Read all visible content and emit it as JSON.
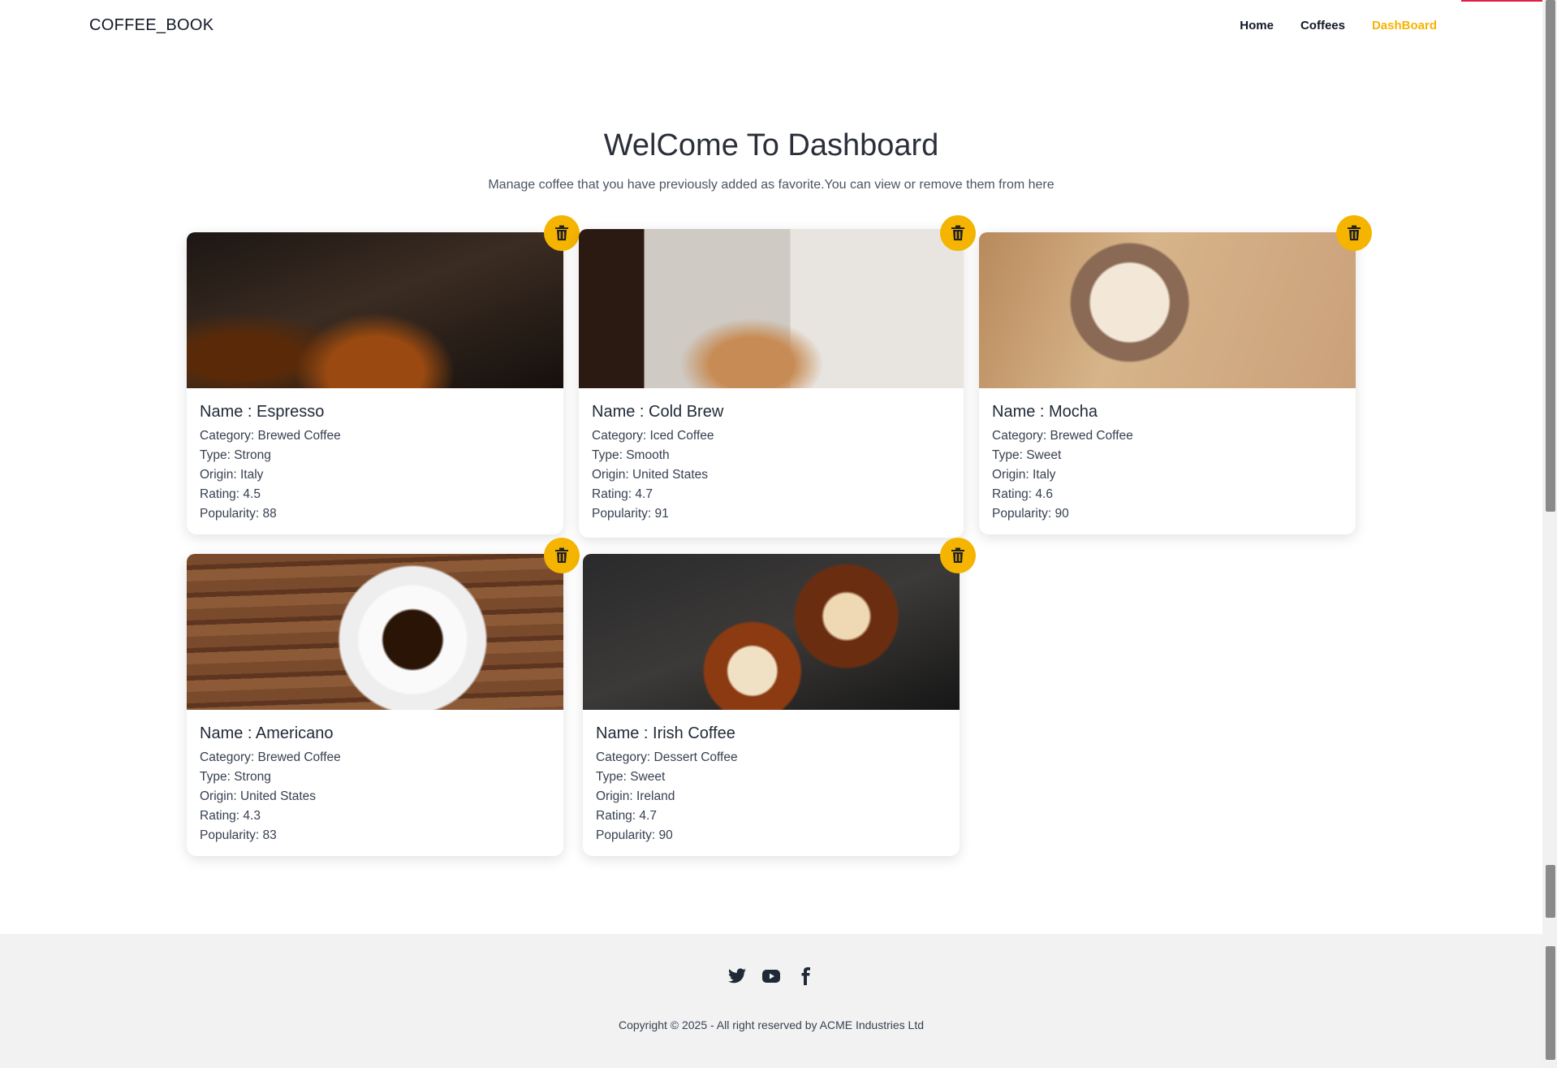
{
  "navbar": {
    "brand": "COFFEE_BOOK",
    "links": [
      {
        "label": "Home"
      },
      {
        "label": "Coffees"
      },
      {
        "label": "DashBoard"
      }
    ]
  },
  "hero": {
    "title": "WelCome To Dashboard",
    "subtitle": "Manage coffee that you have previously added as favorite.You can view or remove them from here"
  },
  "cards": [
    {
      "name": "Name : Espresso",
      "category": "Category: Brewed Coffee",
      "type": "Type: Strong",
      "origin": "Origin: Italy",
      "rating": "Rating: 4.5",
      "popularity": "Popularity: 88"
    },
    {
      "name": "Name : Cold Brew",
      "category": "Category: Iced Coffee",
      "type": "Type: Smooth",
      "origin": "Origin: United States",
      "rating": "Rating: 4.7",
      "popularity": "Popularity: 91"
    },
    {
      "name": "Name : Mocha",
      "category": "Category: Brewed Coffee",
      "type": "Type: Sweet",
      "origin": "Origin: Italy",
      "rating": "Rating: 4.6",
      "popularity": "Popularity: 90"
    },
    {
      "name": "Name : Americano",
      "category": "Category: Brewed Coffee",
      "type": "Type: Strong",
      "origin": "Origin: United States",
      "rating": "Rating: 4.3",
      "popularity": "Popularity: 83"
    },
    {
      "name": "Name : Irish Coffee",
      "category": "Category: Dessert Coffee",
      "type": "Type: Sweet",
      "origin": "Origin: Ireland",
      "rating": "Rating: 4.7",
      "popularity": "Popularity: 90"
    }
  ],
  "footer": {
    "socials": [
      "twitter-icon",
      "youtube-icon",
      "facebook-icon"
    ],
    "copyright": "Copyright © 2025 - All right reserved by ACME Industries Ltd"
  },
  "colors": {
    "accent": "#f5b400",
    "footer_bg": "#f2f2f2"
  }
}
